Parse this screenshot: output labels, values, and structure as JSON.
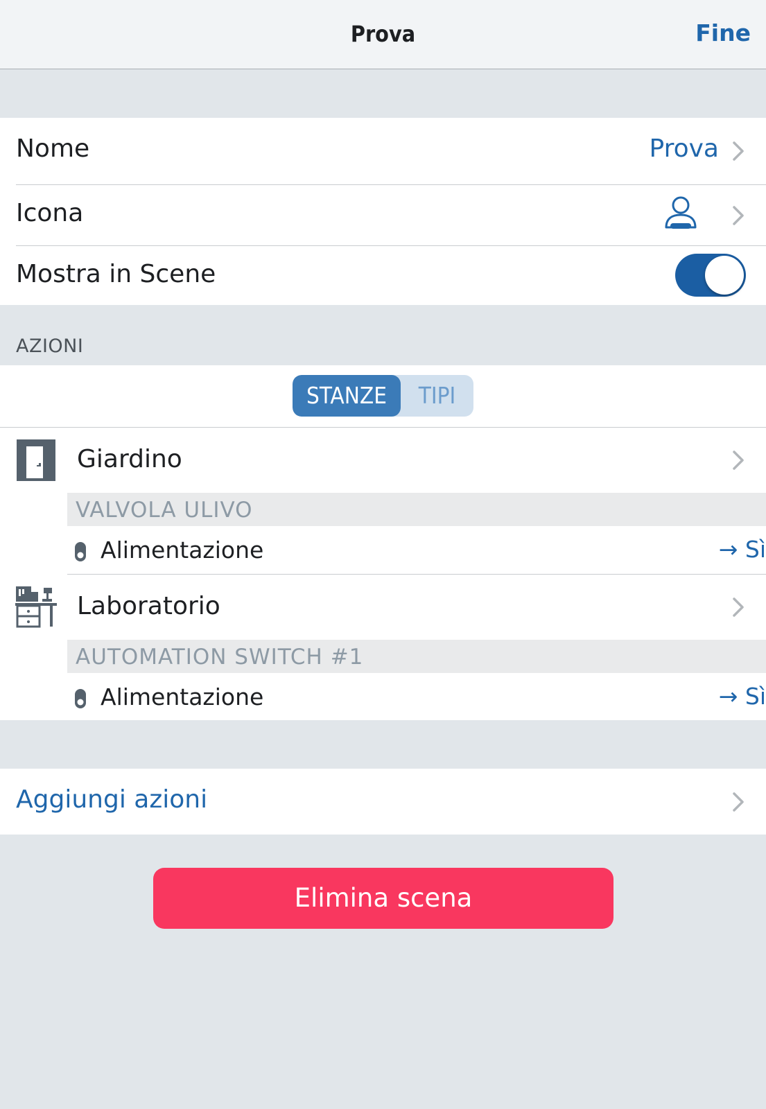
{
  "navbar": {
    "title": "Prova",
    "done_label": "Fine"
  },
  "settings": {
    "name": {
      "label": "Nome",
      "value": "Prova"
    },
    "icon": {
      "label": "Icona",
      "value_icon": "person-icon"
    },
    "show_in_scenes": {
      "label": "Mostra in Scene",
      "enabled": true
    }
  },
  "actions": {
    "header": "AZIONI",
    "segments": [
      {
        "label": "STANZE",
        "selected": true
      },
      {
        "label": "TIPI",
        "selected": false
      }
    ],
    "rooms": [
      {
        "name": "Giardino",
        "icon": "door-icon",
        "device": "VALVOLA ULIVO",
        "action": {
          "label": "Alimentazione",
          "value": "→ Sì",
          "icon": "plug-icon"
        }
      },
      {
        "name": "Laboratorio",
        "icon": "workbench-icon",
        "device": "AUTOMATION SWITCH #1",
        "action": {
          "label": "Alimentazione",
          "value": "→ Sì",
          "icon": "plug-icon"
        }
      }
    ]
  },
  "add_actions": {
    "label": "Aggiungi azioni"
  },
  "delete_button": {
    "label": "Elimina scena"
  },
  "colors": {
    "accent": "#1f66ab",
    "toggle_on": "#1b5ea3",
    "segment_active": "#3b7bb8",
    "destructive": "#f9375f",
    "background": "#e1e6ea"
  }
}
